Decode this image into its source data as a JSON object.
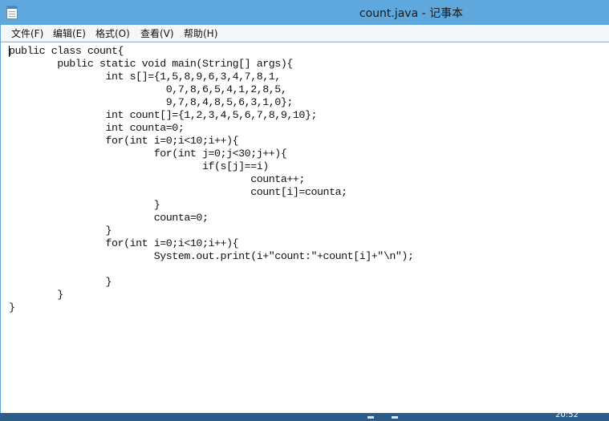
{
  "window": {
    "title": "count.java - 记事本"
  },
  "menu": [
    {
      "label": "文件(F)"
    },
    {
      "label": "编辑(E)"
    },
    {
      "label": "格式(O)"
    },
    {
      "label": "查看(V)"
    },
    {
      "label": "帮助(H)"
    }
  ],
  "editor": {
    "lines": [
      "public class count{",
      "\tpublic static void main(String[] args){",
      "\t\tint s[]={1,5,8,9,6,3,4,7,8,1,",
      "\t\t          0,7,8,6,5,4,1,2,8,5,",
      "\t\t          9,7,8,4,8,5,6,3,1,0};",
      "\t\tint count[]={1,2,3,4,5,6,7,8,9,10};",
      "\t\tint counta=0;",
      "\t\tfor(int i=0;i<10;i++){",
      "\t\t\tfor(int j=0;j<30;j++){",
      "\t\t\t\tif(s[j]==i)",
      "\t\t\t\t\tcounta++;",
      "\t\t\t\t\tcount[i]=counta;",
      "\t\t\t}",
      "\t\t\tcounta=0;",
      "\t\t}",
      "\t\tfor(int i=0;i<10;i++){",
      "\t\t\tSystem.out.print(i+\"count:\"+count[i]+\"\\n\");",
      "",
      "\t\t}",
      "\t}",
      "}"
    ]
  },
  "taskbar": {
    "clock": "20:52"
  }
}
